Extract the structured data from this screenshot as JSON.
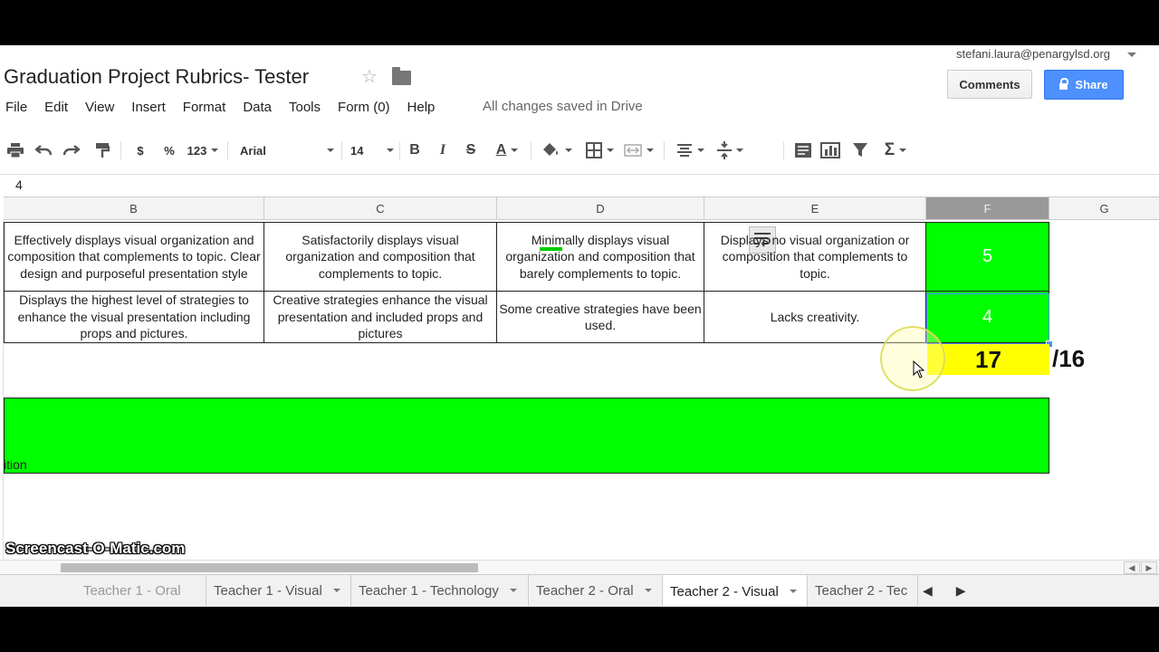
{
  "document": {
    "title": "Graduation Project Rubrics- Tester",
    "account": "stefani.laura@penargylsd.org",
    "comments_label": "Comments",
    "share_label": "Share",
    "save_status": "All changes saved in Drive"
  },
  "menu": [
    "File",
    "Edit",
    "View",
    "Insert",
    "Format",
    "Data",
    "Tools",
    "Form (0)",
    "Help"
  ],
  "toolbar": {
    "currency": "$",
    "percent": "%",
    "number_format": "123",
    "font": "Arial",
    "font_size": "14",
    "bold": "B",
    "italic": "I",
    "strike": "S",
    "text_color": "A",
    "functions": "Σ"
  },
  "formula_bar": {
    "value": "4"
  },
  "columns": [
    "B",
    "C",
    "D",
    "E",
    "F",
    "G"
  ],
  "rows": [
    {
      "b": "Effectively displays visual organization and composition that complements to topic. Clear design and purposeful presentation style",
      "c": "Satisfactorily displays visual organization and composition that complements to topic.",
      "d": "Minimally displays visual organization and composition that barely complements to topic.",
      "e": "Displays no visual organization or composition that complements to topic.",
      "f": "5"
    },
    {
      "b": "Displays the highest level of strategies to enhance the visual presentation including props and pictures.",
      "c": "Creative strategies enhance the visual presentation and included props and pictures",
      "d": "Some creative strategies have been used.",
      "e": "Lacks creativity.",
      "f": "4"
    }
  ],
  "total": {
    "score": "17",
    "out_of": "/16"
  },
  "green_bar_text": "ition",
  "sheet_tabs": [
    "Teacher 1 - Oral",
    "Teacher 1 - Visual",
    "Teacher 1 - Technology",
    "Teacher 2 - Oral",
    "Teacher 2 - Visual",
    "Teacher 2 - Tec"
  ],
  "active_tab": "Teacher 2 - Visual",
  "watermark": "Screencast-O-Matic.com",
  "colors": {
    "cell_green": "#00ff00",
    "total_yellow": "#ffff00",
    "share_blue": "#4d90fe"
  }
}
